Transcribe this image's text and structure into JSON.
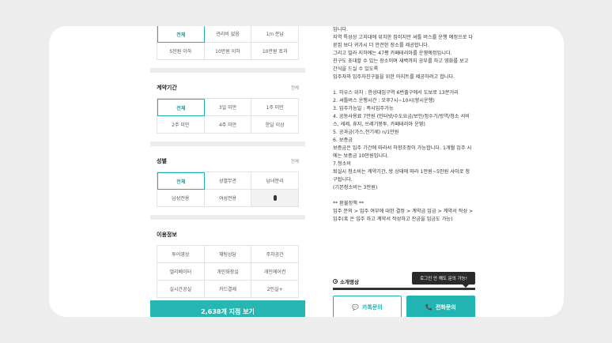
{
  "price_grid": [
    "전체",
    "관리비 없음",
    "1/n 분납",
    "5만원 이하",
    "10만원 이하",
    "10만원 초과"
  ],
  "contract": {
    "title": "계약기간",
    "all_label": "전체",
    "options": [
      "전체",
      "3일 미만",
      "1주 미만",
      "2주 미만",
      "4주 미만",
      "한달 이상"
    ]
  },
  "gender": {
    "title": "성별",
    "all_label": "전체",
    "options": [
      "전체",
      "성별무관",
      "남녀분리",
      "남성전용",
      "여성전용"
    ]
  },
  "usage": {
    "title": "이용정보",
    "options": [
      "투어영상",
      "채팅상담",
      "주차공간",
      "엘리베이터",
      "개인화장실",
      "개인에어컨",
      "실시간공실",
      "카드결제",
      "2인실+"
    ]
  },
  "cta_label": "2,638개 지점 보기",
  "description": "입니다.\n지역 특성상 고지대에 위치한 집이지만 셔틀 버스를 운행 예정으로 다른집 보다 귀가시 더 안전한 장소를 제공합니다.\n그리고 빌라 지하에는 47평 카페테리아를 운영예정입니다.\n친구도 초대할 수 있는 장소이며 새벽까지 공부를 하고 영화를 보고 간식을 드실 수 있도록\n입주자와 입주자친구들을 위한 아지트를 제공하려고 합니다.\n\n1. 하우스 위치 : 한성대입구역 6번출구에서 도보로 13분거리\n2. 셔틀버스 운행시간 : 오후7시~10시(향시운행)\n3. 입주가능일 : 즉시입주가능\n4. 공동사용료 7만원 (인터넷/수도요금/보안/정수기/방역/청소 서비스, 세제, 휴지, 쓰레기봉투, 카페테리아 운영)\n5. 공과금(가스,전기세) n/1만원\n6. 보증금\n보증금은 입주 기간에 따라서 하향조정이 가능합니다. 1개월 입주 시에는 보증금 10만원입니다.\n7.청소비\n퇴실시 청소비는 계약기간, 방 상태에 따라 1만원~5만원 사이로 청구됩니다.\n(기본청소비는 3만원)\n\n** 환불정책 **\n입주 문의 > 입주 여부에 대한 결정 > 계약금 입금 > 계약서 작성 > 입주(혹 은 입주 하고 계약서 작성하고 잔금을 입금도 가능)",
  "video_label": "소개영상",
  "tooltip": "로그인 안 해도 문의 가능!",
  "chat_button": "카톡문의",
  "phone_button": "전화문의",
  "colors": {
    "accent": "#22b4b0",
    "background": "#ededed"
  }
}
